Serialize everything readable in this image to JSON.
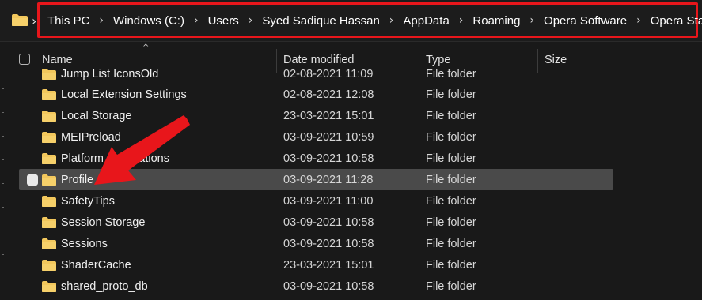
{
  "address_bar": {
    "crumbs": [
      "This PC",
      "Windows (C:)",
      "Users",
      "Syed Sadique Hassan",
      "AppData",
      "Roaming",
      "Opera Software",
      "Opera Stable"
    ],
    "highlight_color": "#e8161b"
  },
  "columns": {
    "name": "Name",
    "date": "Date modified",
    "type": "Type",
    "size": "Size"
  },
  "rows": [
    {
      "name": "Jump List IconsOld",
      "date": "02-08-2021 11:09",
      "type": "File folder"
    },
    {
      "name": "Local Extension Settings",
      "date": "02-08-2021 12:08",
      "type": "File folder"
    },
    {
      "name": "Local Storage",
      "date": "23-03-2021 15:01",
      "type": "File folder"
    },
    {
      "name": "MEIPreload",
      "date": "03-09-2021 10:59",
      "type": "File folder"
    },
    {
      "name": "Platform Notifications",
      "date": "03-09-2021 10:58",
      "type": "File folder"
    },
    {
      "name": "Profile",
      "date": "03-09-2021 11:28",
      "type": "File folder",
      "selected": true
    },
    {
      "name": "SafetyTips",
      "date": "03-09-2021 11:00",
      "type": "File folder"
    },
    {
      "name": "Session Storage",
      "date": "03-09-2021 10:58",
      "type": "File folder"
    },
    {
      "name": "Sessions",
      "date": "03-09-2021 10:58",
      "type": "File folder"
    },
    {
      "name": "ShaderCache",
      "date": "23-03-2021 15:01",
      "type": "File folder"
    },
    {
      "name": "shared_proto_db",
      "date": "03-09-2021 10:58",
      "type": "File folder"
    }
  ],
  "icons": {
    "folder": "folder-icon",
    "chevron": "chevron-right-icon",
    "sort": "sort-up-icon",
    "annotation": "red-arrow-annotation"
  },
  "colors": {
    "folder": "#f2c75c",
    "selection": "#4a4a4a",
    "annotation": "#e8161b"
  }
}
